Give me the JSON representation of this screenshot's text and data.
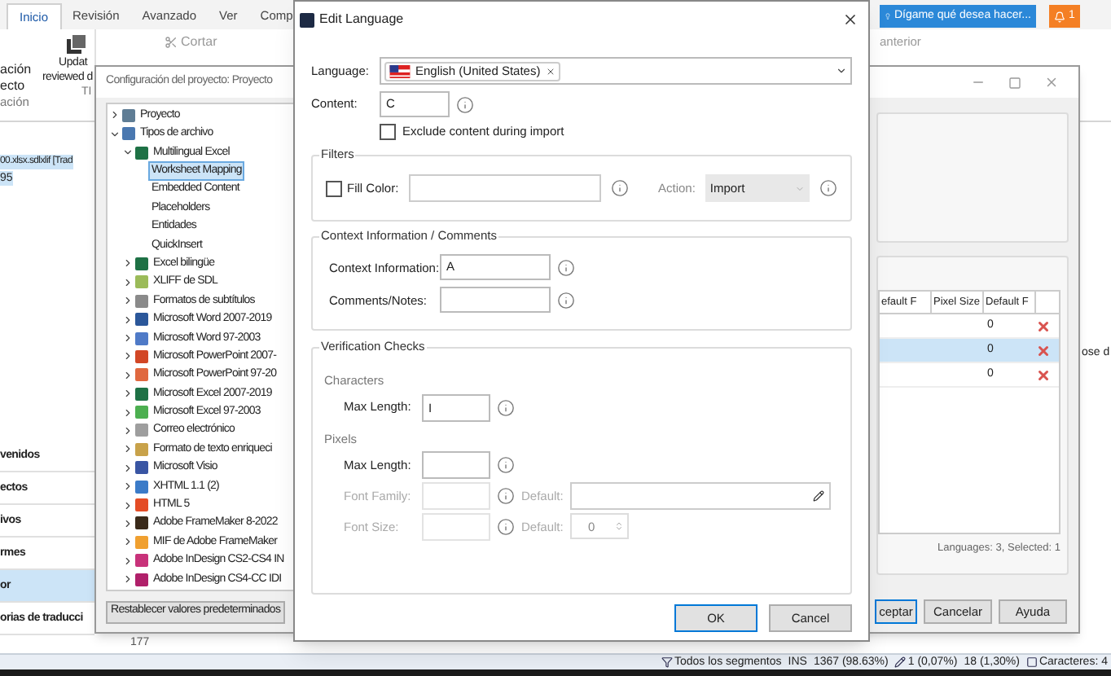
{
  "app": {
    "tabs": [
      {
        "label": "Inicio",
        "selected": true
      },
      {
        "label": "Revisión",
        "selected": false
      },
      {
        "label": "Avanzado",
        "selected": false
      },
      {
        "label": "Ver",
        "selected": false
      },
      {
        "label": "Comp",
        "selected": false
      }
    ],
    "ribbon": {
      "left_lines": [
        "ación",
        "ecto"
      ],
      "left_group": "ación",
      "update_lines": [
        "Updat",
        "reviewed d"
      ],
      "update_group": "TI",
      "cut": "Cortar",
      "tell_me": "Dígame qué desea hacer...",
      "notifications": "1",
      "previous": "anterior"
    },
    "document": {
      "name": "00.xlsx.sdlxlif [Trad",
      "sub": "95"
    },
    "nav": [
      {
        "label": "venidos",
        "selected": false
      },
      {
        "label": "ectos",
        "selected": false
      },
      {
        "label": "ivos",
        "selected": false
      },
      {
        "label": "rmes",
        "selected": false
      },
      {
        "label": "or",
        "selected": true
      },
      {
        "label": "orias de traducci",
        "selected": false
      }
    ],
    "grid_text": "ose d",
    "row_number": "177",
    "status_bar": [
      "Todos los segmentos",
      "INS",
      "1367 (98.63%)",
      "1 (0,07%)",
      "18 (1,30%)",
      "Caracteres: 4"
    ]
  },
  "project_dialog": {
    "title": "Configuración del proyecto: Proyecto",
    "tree": [
      {
        "label": "Proyecto",
        "color": "#5f7d95",
        "expanded": false
      },
      {
        "label": "Tipos de archivo",
        "color": "#4a78b0",
        "expanded": true,
        "children": [
          {
            "label": "Multilingual Excel",
            "color": "#1e7145",
            "expanded": true,
            "children": [
              {
                "label": "Worksheet Mapping",
                "selected": true
              },
              {
                "label": "Embedded Content",
                "selected": false
              },
              {
                "label": "Placeholders",
                "selected": false
              },
              {
                "label": "Entidades",
                "selected": false
              },
              {
                "label": "QuickInsert",
                "selected": false
              }
            ]
          },
          {
            "label": "Excel bilingüe",
            "color": "#1e7145",
            "expanded": false
          },
          {
            "label": "XLIFF de SDL",
            "color": "#9bbb59",
            "expanded": false
          },
          {
            "label": "Formatos de subtítulos",
            "color": "#8a8a8a",
            "expanded": false
          },
          {
            "label": "Microsoft Word 2007-2019",
            "color": "#2b579a",
            "expanded": false
          },
          {
            "label": "Microsoft Word 97-2003",
            "color": "#4f7ac7",
            "expanded": false
          },
          {
            "label": "Microsoft PowerPoint 2007-",
            "color": "#d24726",
            "expanded": false
          },
          {
            "label": "Microsoft PowerPoint 97-20",
            "color": "#e0683f",
            "expanded": false
          },
          {
            "label": "Microsoft Excel 2007-2019",
            "color": "#1e7145",
            "expanded": false
          },
          {
            "label": "Microsoft Excel 97-2003",
            "color": "#4caf50",
            "expanded": false
          },
          {
            "label": "Correo electrónico",
            "color": "#9e9e9e",
            "expanded": false
          },
          {
            "label": "Formato de texto enriqueci",
            "color": "#c8a24a",
            "expanded": false
          },
          {
            "label": "Microsoft Visio",
            "color": "#3955a3",
            "expanded": false
          },
          {
            "label": "XHTML 1.1 (2)",
            "color": "#3b7bc8",
            "expanded": false
          },
          {
            "label": "HTML 5",
            "color": "#e44d26",
            "expanded": false
          },
          {
            "label": "Adobe FrameMaker 8-2022",
            "color": "#3a2a1a",
            "expanded": false
          },
          {
            "label": "MIF de Adobe FrameMaker",
            "color": "#f0a030",
            "expanded": false
          },
          {
            "label": "Adobe InDesign CS2-CS4 IN",
            "color": "#c8327a",
            "expanded": false
          },
          {
            "label": "Adobe InDesign CS4-CC IDI",
            "color": "#b0206a",
            "expanded": false
          }
        ]
      }
    ],
    "table": {
      "columns": [
        "efault F",
        "Pixel Size",
        "Default F"
      ],
      "rows": [
        {
          "value": "0",
          "selected": false
        },
        {
          "value": "0",
          "selected": true
        },
        {
          "value": "0",
          "selected": false
        }
      ]
    },
    "summary": "Languages: 3, Selected: 1",
    "reset_button": "Restablecer valores predeterminados",
    "buttons": [
      "ceptar",
      "Cancelar",
      "Ayuda"
    ]
  },
  "edit_language": {
    "title": "Edit Language",
    "language_label": "Language:",
    "language_tag": "English (United States)",
    "content_label": "Content:",
    "content_value": "C",
    "exclude": {
      "label": "Exclude content during import",
      "checked": false
    },
    "filters": {
      "title": "Filters",
      "fill_color": {
        "label": "Fill Color:",
        "checked": false
      },
      "action_label": "Action:",
      "action_value": "Import"
    },
    "context": {
      "title": "Context Information / Comments",
      "fields": [
        {
          "label": "Context Information:",
          "value": "A"
        },
        {
          "label": "Comments/Notes:"
        }
      ]
    },
    "verification": {
      "title": "Verification Checks",
      "characters_title": "Characters",
      "characters": [
        {
          "label": "Max Length:",
          "value": "I",
          "disabled": false
        }
      ],
      "pixels_title": "Pixels",
      "pixels": [
        {
          "label": "Max Length:",
          "disabled": false
        },
        {
          "label": "Font Family:",
          "disabled": true,
          "default_label": "Default:",
          "kind": "text"
        },
        {
          "label": "Font Size:",
          "disabled": true,
          "default_label": "Default:",
          "kind": "spinner",
          "default_value": "0"
        }
      ]
    },
    "buttons": [
      "OK",
      "Cancel"
    ]
  }
}
